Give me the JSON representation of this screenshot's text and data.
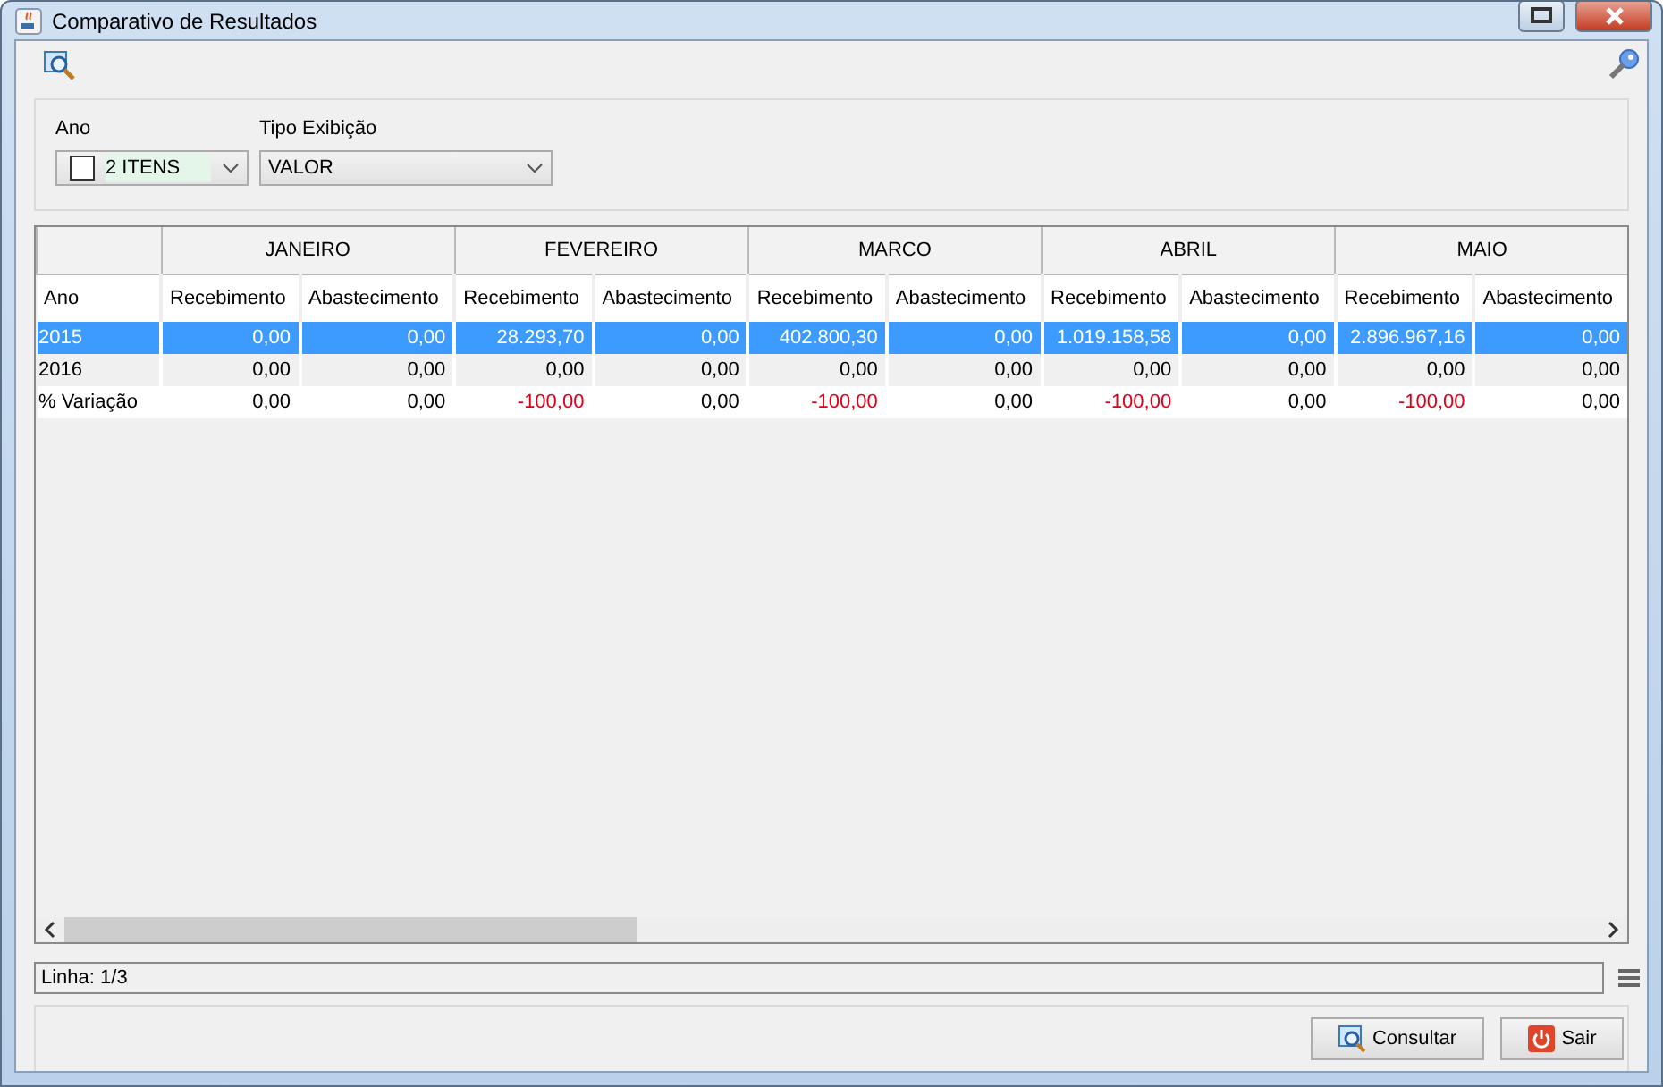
{
  "window": {
    "title": "Comparativo de Resultados"
  },
  "filters": {
    "ano": {
      "label": "Ano",
      "value": "2 ITENS",
      "checked": false
    },
    "tipo": {
      "label": "Tipo Exibição",
      "value": "VALOR"
    }
  },
  "table": {
    "first_column": "Ano",
    "months": [
      {
        "name": "JANEIRO",
        "subcolumns": [
          "Recebimento",
          "Abastecimento"
        ]
      },
      {
        "name": "FEVEREIRO",
        "subcolumns": [
          "Recebimento",
          "Abastecimento"
        ]
      },
      {
        "name": "MARCO",
        "subcolumns": [
          "Recebimento",
          "Abastecimento"
        ]
      },
      {
        "name": "ABRIL",
        "subcolumns": [
          "Recebimento",
          "Abastecimento"
        ]
      },
      {
        "name": "MAIO",
        "subcolumns": [
          "Recebimento",
          "Abastecimento"
        ]
      }
    ],
    "rows": [
      {
        "label": "2015",
        "selected": true,
        "cells": [
          {
            "text": "0,00",
            "negative": false
          },
          {
            "text": "0,00",
            "negative": false
          },
          {
            "text": "28.293,70",
            "negative": false
          },
          {
            "text": "0,00",
            "negative": false
          },
          {
            "text": "402.800,30",
            "negative": false
          },
          {
            "text": "0,00",
            "negative": false
          },
          {
            "text": "1.019.158,58",
            "negative": false
          },
          {
            "text": "0,00",
            "negative": false
          },
          {
            "text": "2.896.967,16",
            "negative": false
          },
          {
            "text": "0,00",
            "negative": false
          }
        ]
      },
      {
        "label": "2016",
        "selected": false,
        "cells": [
          {
            "text": "0,00",
            "negative": false
          },
          {
            "text": "0,00",
            "negative": false
          },
          {
            "text": "0,00",
            "negative": false
          },
          {
            "text": "0,00",
            "negative": false
          },
          {
            "text": "0,00",
            "negative": false
          },
          {
            "text": "0,00",
            "negative": false
          },
          {
            "text": "0,00",
            "negative": false
          },
          {
            "text": "0,00",
            "negative": false
          },
          {
            "text": "0,00",
            "negative": false
          },
          {
            "text": "0,00",
            "negative": false
          }
        ]
      },
      {
        "label": "% Variação",
        "selected": false,
        "cells": [
          {
            "text": "0,00",
            "negative": false
          },
          {
            "text": "0,00",
            "negative": false
          },
          {
            "text": "-100,00",
            "negative": true
          },
          {
            "text": "0,00",
            "negative": false
          },
          {
            "text": "-100,00",
            "negative": true
          },
          {
            "text": "0,00",
            "negative": false
          },
          {
            "text": "-100,00",
            "negative": true
          },
          {
            "text": "0,00",
            "negative": false
          },
          {
            "text": "-100,00",
            "negative": true
          },
          {
            "text": "0,00",
            "negative": false
          }
        ]
      }
    ]
  },
  "status": "Linha: 1/3",
  "buttons": [
    {
      "label": "Consultar",
      "kind": "search"
    },
    {
      "label": "Sair",
      "kind": "exit"
    }
  ]
}
